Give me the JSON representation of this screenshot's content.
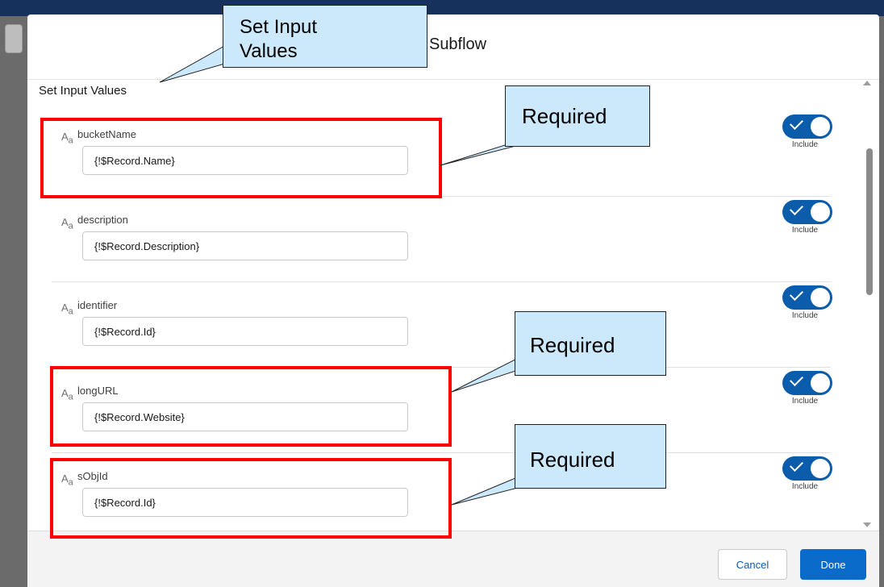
{
  "dialog": {
    "title_visible": "t Subflow",
    "section_title": "Set Input Values"
  },
  "fields": [
    {
      "label": "bucketName",
      "value": "{!$Record.Name}",
      "include_label": "Include",
      "include_on": true
    },
    {
      "label": "description",
      "value": "{!$Record.Description}",
      "include_label": "Include",
      "include_on": true
    },
    {
      "label": "identifier",
      "value": "{!$Record.Id}",
      "include_label": "Include",
      "include_on": true
    },
    {
      "label": "longURL",
      "value": "{!$Record.Website}",
      "include_label": "Include",
      "include_on": true
    },
    {
      "label": "sObjId",
      "value": "{!$Record.Id}",
      "include_label": "Include",
      "include_on": true
    }
  ],
  "footer": {
    "cancel_label": "Cancel",
    "done_label": "Done"
  },
  "annotations": {
    "top_callout_line1": "Set Input",
    "top_callout_line2": "Values",
    "required_1": "Required",
    "required_2": "Required",
    "required_3": "Required"
  },
  "colors": {
    "accent": "#0b5cab",
    "highlight_box": "#ff0000",
    "callout_fill": "#cce8fb"
  }
}
